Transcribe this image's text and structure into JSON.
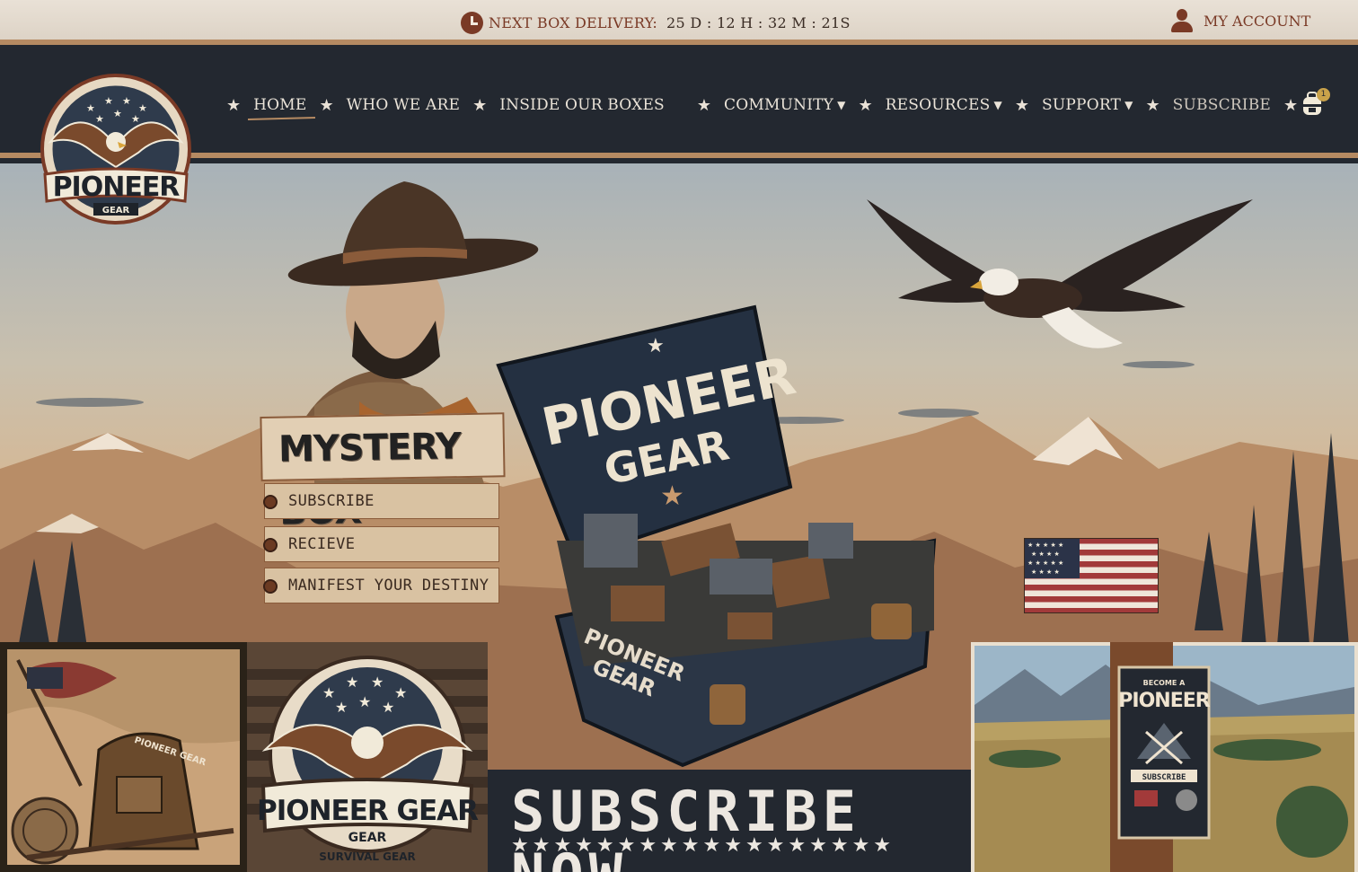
{
  "topbar": {
    "delivery_label": "NEXT BOX DELIVERY:",
    "countdown": "25 D : 12 H : 32 M : 21S",
    "account_label": "MY ACCOUNT"
  },
  "brand": {
    "logo_text": "PIONEER",
    "logo_subtext": "GEAR"
  },
  "nav": {
    "items": [
      {
        "label": "HOME",
        "active": true
      },
      {
        "label": "WHO WE ARE"
      },
      {
        "label": "INSIDE OUR BOXES"
      },
      {
        "label": "COMMUNITY",
        "dropdown": true
      },
      {
        "label": "RESOURCES",
        "dropdown": true
      },
      {
        "label": "SUPPORT",
        "dropdown": true
      },
      {
        "label": "SUBSCRIBE"
      }
    ],
    "cart_count": "1"
  },
  "hero": {
    "sign_title": "MYSTERY BOX",
    "sign_steps": [
      "SUBSCRIBE",
      "RECIEVE",
      "MANIFEST YOUR DESTINY"
    ],
    "box_title": "PIONEER",
    "box_subtitle": "GEAR",
    "box_side_text_1": "PIONEER",
    "box_side_text_2": "GEAR"
  },
  "tiles": {
    "pioneer_gear_badge_title": "PIONEER GEAR",
    "pioneer_gear_badge_sub": "GEAR",
    "pioneer_gear_badge_ribbon": "SURVIVAL GEAR",
    "backpack_label": "PIONEER GEAR",
    "poster_top": "BECOME A",
    "poster_title": "PIONEER",
    "poster_ribbon": "SUBSCRIBE"
  },
  "cta": {
    "label": "SUBSCRIBE NOW",
    "stars": "★★★★★★★★★★★★★★★★★★"
  },
  "colors": {
    "navy": "#232830",
    "accent_brown": "#7a3a26",
    "copper_rule": "#b58a62",
    "cream": "#e9e1d6"
  }
}
